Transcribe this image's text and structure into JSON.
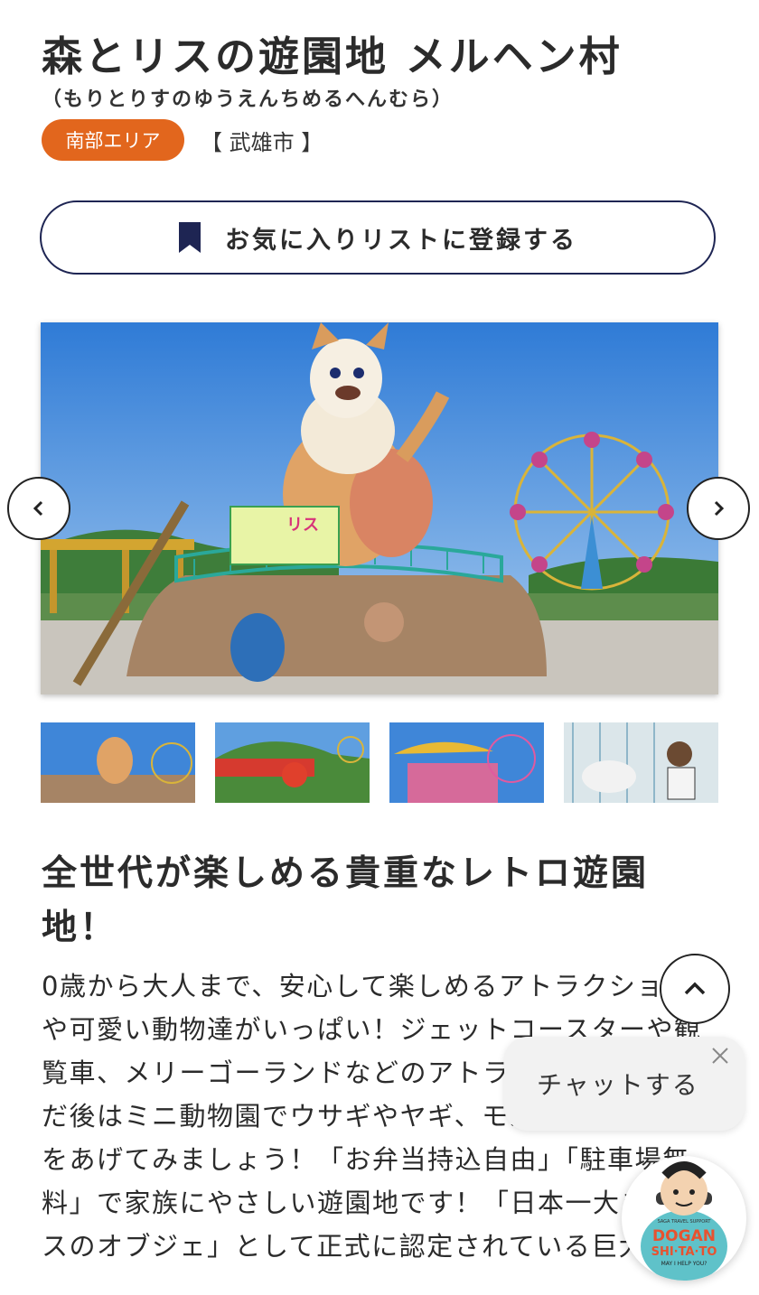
{
  "header": {
    "title": "森とリスの遊園地 メルヘン村",
    "reading": "（もりとりすのゆうえんちめるへんむら）",
    "area_badge": "南部エリア",
    "city": "【 武雄市 】"
  },
  "favorite_button": {
    "label": "お気に入りリストに登録する",
    "icon": "bookmark-icon"
  },
  "gallery": {
    "icons": {
      "prev": "chevron-left-icon",
      "next": "chevron-right-icon"
    },
    "hero_sign_text": "リス",
    "thumbnail_count": 4
  },
  "content": {
    "heading": "全世代が楽しめる貴重なレトロ遊園地！",
    "body": "0歳から大人まで、安心して楽しめるアトラクションや可愛い動物達がいっぱい！ジェットコースターや観覧車、メリーゴーランドなどのアトラクションで遊んだ後はミニ動物園でウサギやヤギ、モルモットにエサをあげてみましょう！「お弁当持込自由」「駐車場無料」で家族にやさしい遊園地です！「日本一大きなリスのオブジェ」として正式に認定されている巨大リ"
  },
  "floating": {
    "scroll_top_icon": "chevron-up-icon",
    "chat_label": "チャットする",
    "chat_close_icon": "close-icon",
    "mascot_text": "DOGAN",
    "mascot_text2": "SHI·TA·TO",
    "mascot_tagline": "MAY I HELP YOU?",
    "mascot_small": "SAGA TRAVEL SUPPORT"
  },
  "colors": {
    "accent_orange": "#e2661d",
    "navy": "#1e2553",
    "sky": "#3f86d8"
  }
}
